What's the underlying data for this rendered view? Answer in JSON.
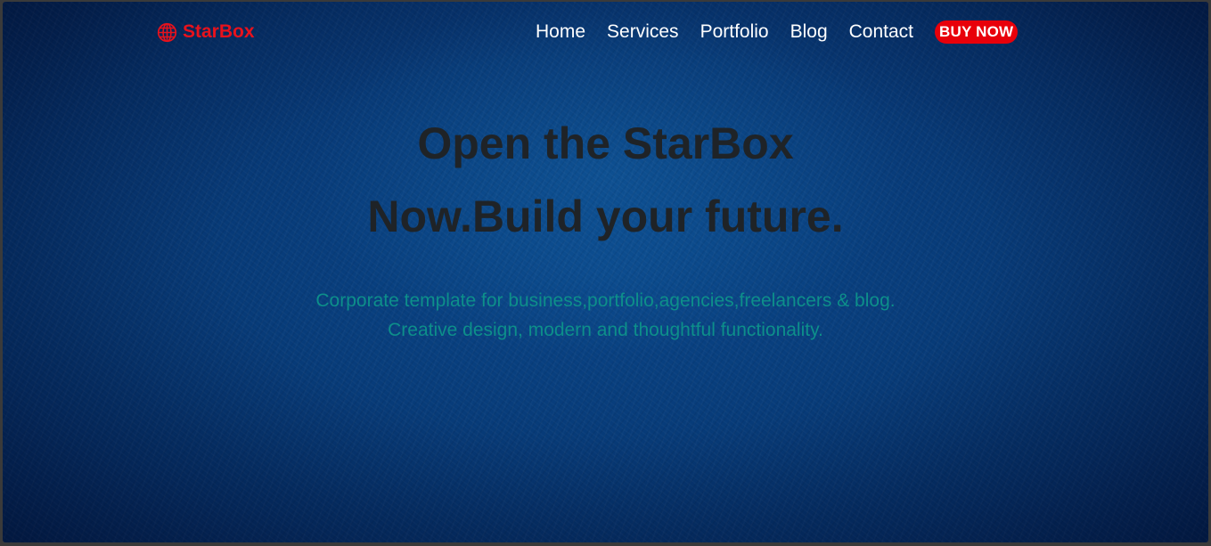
{
  "colors": {
    "brand": "#e8121c",
    "button_bg": "#e8000a",
    "nav_text": "#ffffff",
    "headline": "#1f2327",
    "subtext": "#0d8f8a"
  },
  "nav": {
    "brand": {
      "icon": "globe-icon",
      "name": "StarBox"
    },
    "items": [
      {
        "label": "Home"
      },
      {
        "label": "Services"
      },
      {
        "label": "Portfolio"
      },
      {
        "label": "Blog"
      },
      {
        "label": "Contact"
      }
    ],
    "cta": {
      "label": "BUY NOW"
    }
  },
  "hero": {
    "title_lines": [
      "Open the StarBox",
      "Now.Build your future."
    ],
    "subtitle_lines": [
      "Corporate template for business,portfolio,agencies,freelancers & blog.",
      "Creative design, modern and thoughtful functionality."
    ]
  }
}
